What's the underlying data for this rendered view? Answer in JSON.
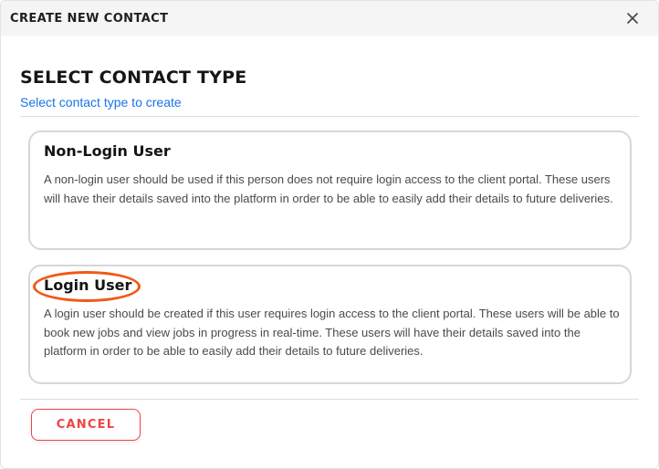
{
  "modal": {
    "title": "CREATE NEW CONTACT",
    "close_icon": "close-icon"
  },
  "section": {
    "title": "SELECT CONTACT TYPE",
    "subtitle": "Select contact type to create"
  },
  "contact_types": [
    {
      "title": "Non-Login User",
      "description": "A non-login user should be used if this person does not require login access to the client portal. These users will have their details saved into the platform in order to be able to easily add their details to future deliveries."
    },
    {
      "title": "Login User",
      "description": "A login user should be created if this user requires login access to the client portal. These users will be able to book new jobs and view jobs in progress in real-time. These users will have their details saved into the platform in order to be able to easily add their details to future deliveries.",
      "highlighted": true
    }
  ],
  "footer": {
    "cancel_label": "CANCEL"
  },
  "colors": {
    "accent_link": "#1a73e8",
    "cancel": "#ef4444",
    "highlight_ring": "#ef5a14",
    "card_border": "#d6d6de",
    "header_bg": "#f5f5f5"
  }
}
